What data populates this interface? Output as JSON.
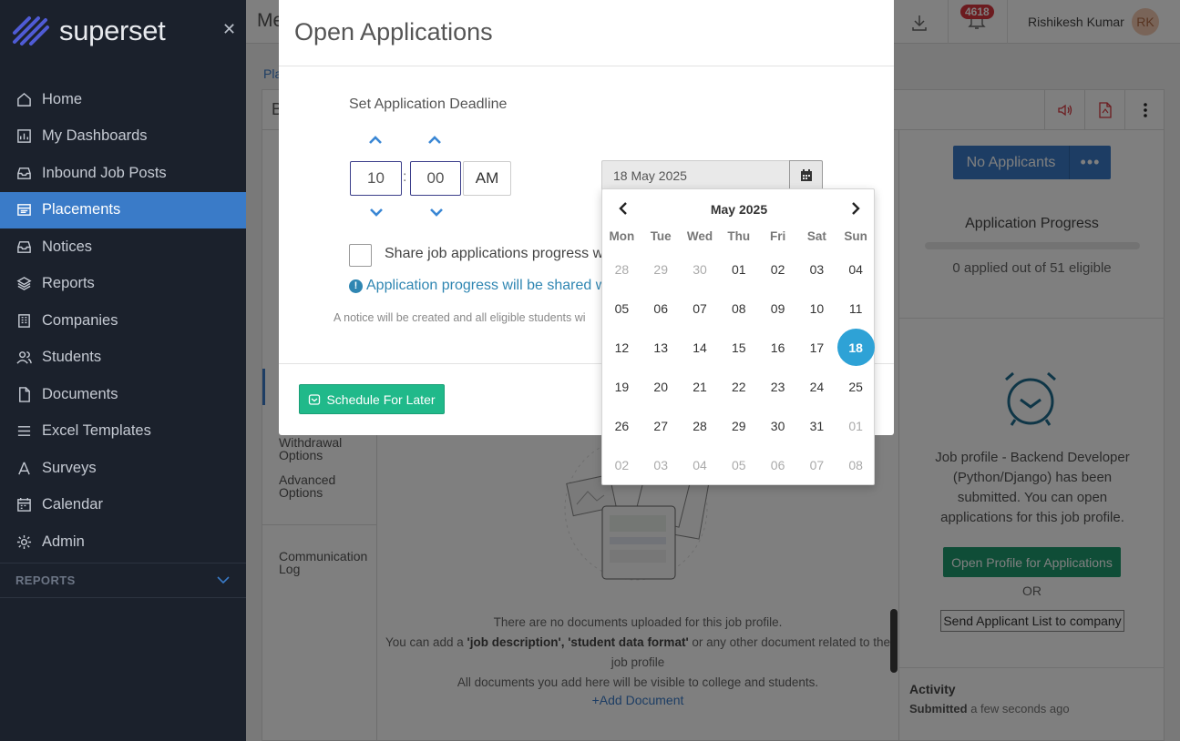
{
  "app": {
    "name": "superset"
  },
  "sidebar": {
    "items": [
      {
        "label": "Home",
        "icon": "home-icon"
      },
      {
        "label": "My Dashboards",
        "icon": "dashboard-icon"
      },
      {
        "label": "Inbound Job Posts",
        "icon": "inbox-icon"
      },
      {
        "label": "Placements",
        "icon": "placements-icon"
      },
      {
        "label": "Notices",
        "icon": "notice-icon"
      },
      {
        "label": "Reports",
        "icon": "layers-icon"
      },
      {
        "label": "Companies",
        "icon": "building-icon"
      },
      {
        "label": "Students",
        "icon": "users-icon"
      },
      {
        "label": "Documents",
        "icon": "document-icon"
      },
      {
        "label": "Excel Templates",
        "icon": "list-icon"
      },
      {
        "label": "Surveys",
        "icon": "survey-icon"
      },
      {
        "label": "Calendar",
        "icon": "calendar-icon"
      },
      {
        "label": "Admin",
        "icon": "gear-icon"
      }
    ],
    "active": "Placements",
    "section_label": "REPORTS"
  },
  "topbar": {
    "title": "Me",
    "notification_count": "4618",
    "user_name": "Rishikesh Kumar",
    "user_initials": "RK"
  },
  "background": {
    "breadcrumb": "Pla",
    "panel_letter": "B",
    "left_links": [
      "Withdrawal Options",
      "Advanced Options",
      "Communication Log"
    ],
    "no_applicants_label": "No Applicants",
    "more_label": "•••",
    "progress_title": "Application Progress",
    "progress_fraction": 0,
    "progress_text": "0 applied out of 51 eligible",
    "job_profile_text": "Job profile - Backend Developer (Python/Django) has been submitted. You can open applications for this job profile.",
    "open_profile_label": "Open Profile for Applications",
    "or_label": "OR",
    "send_list_label": "Send Applicant List to company",
    "activity_label": "Activity",
    "activity_status": "Submitted",
    "activity_time": "a few seconds ago",
    "docs_line1": "There are no documents uploaded for this job profile.",
    "docs_line2_pre": "You can add a ",
    "docs_line2_bold": "'job description', 'student data format'",
    "docs_line2_post": " or any other document related to the job profile",
    "docs_line3": "All documents you add here will be visible to college and students.",
    "add_document_label": "Add Document"
  },
  "modal": {
    "title": "Open Applications",
    "deadline_label": "Set Application Deadline",
    "hour": "10",
    "minute": "00",
    "ampm": "AM",
    "date_value": "18 May 2025",
    "share_label": "Share job applications progress wi",
    "info_text": "Application progress will be shared w",
    "notice_text": "A notice will be created and all eligible students wi",
    "schedule_label": "Schedule For Later"
  },
  "calendar": {
    "month_label": "May 2025",
    "weekdays": [
      "Mon",
      "Tue",
      "Wed",
      "Thu",
      "Fri",
      "Sat",
      "Sun"
    ],
    "weeks": [
      [
        "28",
        "29",
        "30",
        "01",
        "02",
        "03",
        "04"
      ],
      [
        "05",
        "06",
        "07",
        "08",
        "09",
        "10",
        "11"
      ],
      [
        "12",
        "13",
        "14",
        "15",
        "16",
        "17",
        "18"
      ],
      [
        "19",
        "20",
        "21",
        "22",
        "23",
        "24",
        "25"
      ],
      [
        "26",
        "27",
        "28",
        "29",
        "30",
        "31",
        "01"
      ],
      [
        "02",
        "03",
        "04",
        "05",
        "06",
        "07",
        "08"
      ]
    ],
    "muted": [
      [
        0,
        0
      ],
      [
        0,
        1
      ],
      [
        0,
        2
      ],
      [
        4,
        6
      ],
      [
        5,
        0
      ],
      [
        5,
        1
      ],
      [
        5,
        2
      ],
      [
        5,
        3
      ],
      [
        5,
        4
      ],
      [
        5,
        5
      ],
      [
        5,
        6
      ]
    ],
    "selected": [
      2,
      6
    ]
  },
  "colors": {
    "sidebar_bg": "#1b212c",
    "accent": "#3a7bc8",
    "selected_day": "#2ea2d6",
    "schedule_button": "#20b98a",
    "open_profile_button": "#1e9a6e",
    "badge": "#d9363e"
  }
}
